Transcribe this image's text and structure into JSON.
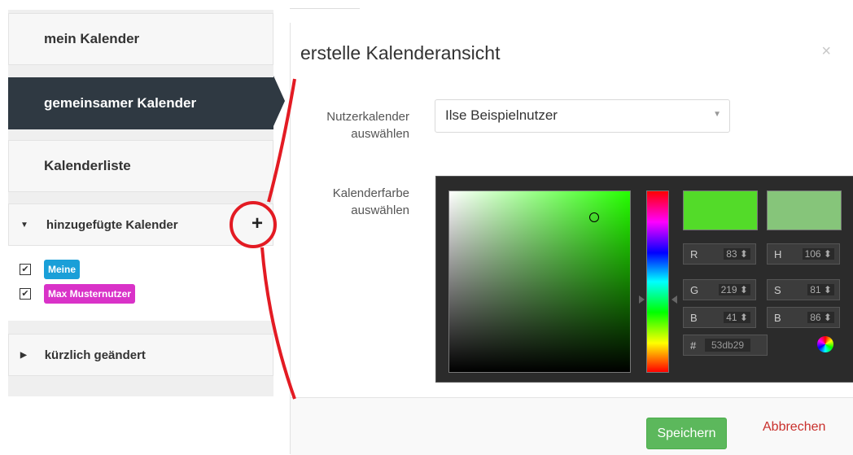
{
  "sidebar": {
    "nav": [
      "mein Kalender",
      "gemeinsamer Kalender",
      "Kalenderliste"
    ],
    "added_panel_title": "hinzugefügte Kalender",
    "added_add_icon": "plus-icon",
    "calendars": [
      {
        "label": "Meine",
        "color": "#1a9fd8",
        "checked": true
      },
      {
        "label": "Max Musternutzer",
        "color": "#d932c8",
        "checked": true
      }
    ],
    "recent_panel_title": "kürzlich geändert"
  },
  "dialog": {
    "title": "erstelle Kalenderansicht",
    "close_icon": "×",
    "user_label": "Nutzerkalender auswählen",
    "user_value": "Ilse Beispielnutzer",
    "color_label": "Kalenderfarbe auswählen",
    "picker": {
      "new_color": "#53db29",
      "current_color": "#86c57a",
      "R": "83",
      "G": "219",
      "B": "41",
      "H": "106",
      "S": "81",
      "Bv": "86",
      "hex": "53db29"
    },
    "save_label": "Speichern",
    "cancel_label": "Abbrechen"
  },
  "annotation": {
    "color": "#e31b23"
  }
}
